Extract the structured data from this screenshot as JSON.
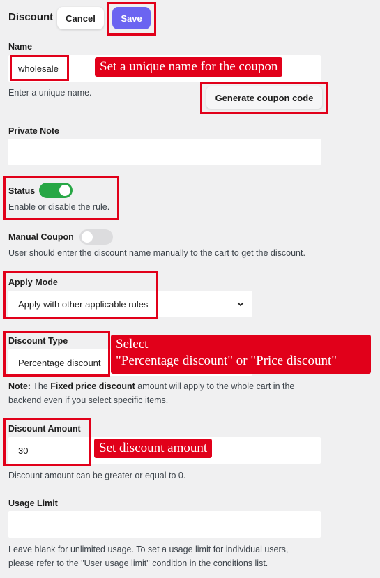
{
  "header": {
    "title": "Discount",
    "cancel_label": "Cancel",
    "save_label": "Save"
  },
  "name_field": {
    "label": "Name",
    "value": "wholesale",
    "help": "Enter a unique name.",
    "generate_label": "Generate coupon code"
  },
  "private_note": {
    "label": "Private Note",
    "value": ""
  },
  "status": {
    "label": "Status",
    "enabled": true,
    "help": "Enable or disable the rule."
  },
  "manual_coupon": {
    "label": "Manual Coupon",
    "enabled": false,
    "help": "User should enter the discount name manually to the cart to get the discount."
  },
  "apply_mode": {
    "label": "Apply Mode",
    "selected": "Apply with other applicable rules"
  },
  "discount_type": {
    "label": "Discount Type",
    "selected": "Percentage discount",
    "note_prefix": "Note:",
    "note_text_1": " The ",
    "note_bold": "Fixed price discount",
    "note_text_2": " amount will apply to the whole cart in the",
    "note_text_3": "backend even if you select specific items."
  },
  "discount_amount": {
    "label": "Discount Amount",
    "value": "30",
    "help": "Discount amount can be greater or equal to 0."
  },
  "usage_limit": {
    "label": "Usage Limit",
    "value": "",
    "help_line1": "Leave blank for unlimited usage. To set a usage limit for individual users,",
    "help_line2": "please refer to the \"User usage limit\" condition in the conditions list."
  },
  "annotations": {
    "name_callout": "Set a unique name for the coupon",
    "type_callout_line1": "Select",
    "type_callout_line2": "\"Percentage discount\" or \"Price discount\"",
    "amount_callout": "Set discount amount"
  },
  "colors": {
    "accent": "#6b64f1",
    "toggle_on": "#27a745",
    "annotation_red": "#e1001a",
    "background": "#f0f0f1"
  }
}
